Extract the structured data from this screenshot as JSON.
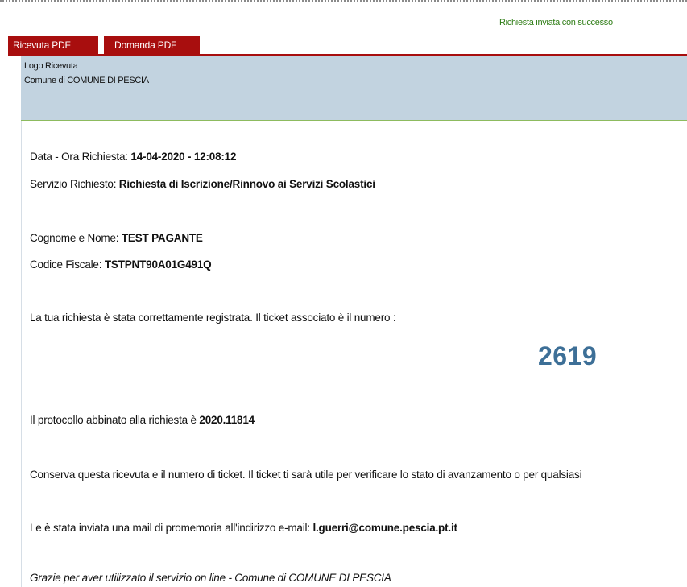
{
  "status": {
    "message": "Richiesta inviata con successo"
  },
  "tabs": [
    {
      "label": "Ricevuta PDF"
    },
    {
      "label": "Domanda PDF"
    }
  ],
  "header": {
    "logo_label": "Logo Ricevuta",
    "comune": "Comune di COMUNE DI PESCIA"
  },
  "receipt": {
    "datetime_label": "Data - Ora Richiesta: ",
    "datetime_value": "14-04-2020 - 12:08:12",
    "service_label": "Servizio Richiesto: ",
    "service_value": "Richiesta di Iscrizione/Rinnovo ai Servizi Scolastici",
    "name_label": "Cognome e Nome: ",
    "name_value": "TEST PAGANTE",
    "cf_label": "Codice Fiscale: ",
    "cf_value": "TSTPNT90A01G491Q",
    "registered_text": "La tua richiesta è stata correttamente registrata. Il ticket associato è il numero :",
    "ticket_number": "2619",
    "protocol_label": "Il protocollo abbinato alla richiesta è ",
    "protocol_value": "2020.11814",
    "keep_text": "Conserva questa ricevuta e il numero di ticket. Il ticket ti sarà utile per verificare lo stato di avanzamento o per qualsiasi",
    "mail_label": "Le è stata inviata una mail di promemoria all'indirizzo e-mail: ",
    "mail_value": "l.guerri@comune.pescia.pt.it",
    "thanks_text": "Grazie per aver utilizzato il servizio on line - Comune di COMUNE DI PESCIA"
  },
  "colors": {
    "tab_bg": "#a80e0e",
    "header_bg": "#c2d3e0",
    "success_text": "#2f7d16",
    "ticket_text": "#3d6f97"
  }
}
